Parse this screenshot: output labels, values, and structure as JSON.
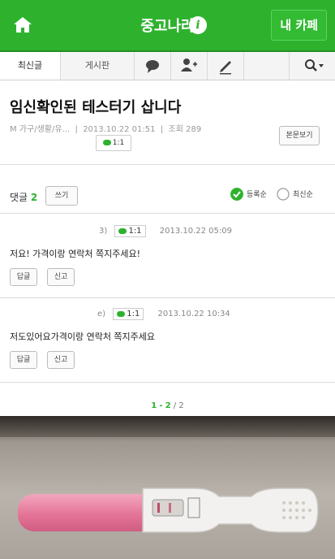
{
  "header": {
    "title": "중고나라",
    "info_icon": "i",
    "my_cafe": "내 카페"
  },
  "tabs": {
    "latest": "최신글",
    "board": "게시판"
  },
  "post": {
    "title": "임신확인된 테스터기 삽니다",
    "meta_author": "M 가구/생활/유...",
    "meta_date": "2013.10.22 01:51",
    "meta_views": "조회 289",
    "talk_label": "1:1",
    "view_original": "본문보기"
  },
  "comments_section": {
    "label": "댓글",
    "count": "2",
    "write_label": "쓰기",
    "sort_registered": "등록순",
    "sort_latest": "최신순"
  },
  "comments": [
    {
      "author_suffix": "3)",
      "talk": "1:1",
      "date": "2013.10.22 05:09",
      "text": "저요! 가격이랑 연락처 쪽지주세요!",
      "reply": "답글",
      "report": "신고"
    },
    {
      "author_suffix": "e)",
      "talk": "1:1",
      "date": "2013.10.22 10:34",
      "text": "저도있어요가격이랑 연락처 쪽지주세요",
      "reply": "답글",
      "report": "신고"
    }
  ],
  "pager": {
    "current": "1",
    "separator1": "-",
    "page2": "2",
    "separator2": "/",
    "total": "2"
  },
  "colors": {
    "brand_green": "#2eb22e",
    "pink": "#e47497"
  },
  "icons": [
    "home-icon",
    "info-icon",
    "chat-icon",
    "add-friend-icon",
    "pencil-icon",
    "search-icon",
    "check-circle-icon"
  ]
}
